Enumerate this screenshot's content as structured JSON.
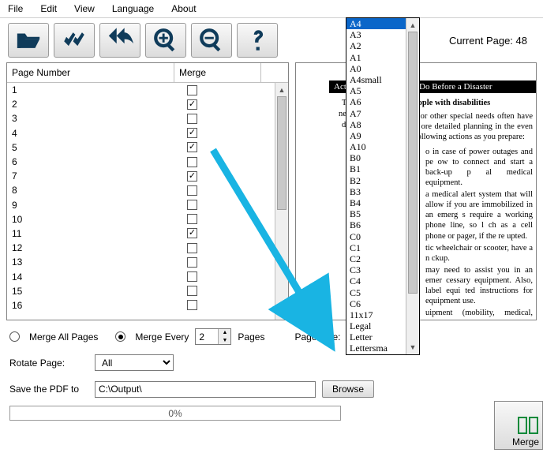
{
  "menu": {
    "file": "File",
    "edit": "Edit",
    "view": "View",
    "language": "Language",
    "about": "About"
  },
  "toolbar": {
    "icons": {
      "open": "open-icon",
      "apply": "apply-icon",
      "undo": "undo-icon",
      "zoomin": "zoomin-icon",
      "zoomout": "zoomout-icon",
      "help": "help-icon"
    },
    "current_page_label": "Current Page: 48"
  },
  "grid": {
    "header_page": "Page Number",
    "header_merge": "Merge",
    "rows": [
      {
        "n": "1",
        "checked": false
      },
      {
        "n": "2",
        "checked": true
      },
      {
        "n": "3",
        "checked": false
      },
      {
        "n": "4",
        "checked": true
      },
      {
        "n": "5",
        "checked": true
      },
      {
        "n": "6",
        "checked": false
      },
      {
        "n": "7",
        "checked": true
      },
      {
        "n": "8",
        "checked": false
      },
      {
        "n": "9",
        "checked": false
      },
      {
        "n": "10",
        "checked": false
      },
      {
        "n": "11",
        "checked": true
      },
      {
        "n": "12",
        "checked": false
      },
      {
        "n": "13",
        "checked": false
      },
      {
        "n": "14",
        "checked": false
      },
      {
        "n": "15",
        "checked": false
      },
      {
        "n": "16",
        "checked": false
      }
    ]
  },
  "preview": {
    "bar1": "Action",
    "bar2": "Do Before a Disaster",
    "title": "eople with disabilities",
    "para": "s or other special needs often have u ore detailed planning in the even following actions as you prepare:",
    "bullets": [
      "o in case of power outages and pe   ow to connect and start a back-up p   al medical equipment.",
      "a medical alert system that will allow   if you are immobilized in an emerg   s require a working phone line, so l   ch as a cell phone or pager, if the re   upted.",
      "tic wheelchair or scooter, have a n   ckup.",
      "may need to assist you in an emer   cessary equipment. Also, label equi   ted instructions for equipment use.",
      "uipment (mobility, medical, etc.) a   school, or your workplace."
    ],
    "snip1": "T",
    "snip2": "ne",
    "snip3": "di"
  },
  "controls": {
    "merge_all": "Merge All Pages",
    "merge_every": "Merge Every",
    "merge_every_value": "2",
    "pages_label": "Pages",
    "page_size_label": "Page Size:",
    "page_size_value": "A4",
    "rotate_label": "Rotate Page:",
    "rotate_value": "All",
    "save_label": "Save the PDF to",
    "save_path": "C:\\Output\\",
    "browse": "Browse",
    "progress": "0%",
    "merge_button": "Merge"
  },
  "dropdown": {
    "selected": "A4",
    "items": [
      "A4",
      "A3",
      "A2",
      "A1",
      "A0",
      "A4small",
      "A5",
      "A6",
      "A7",
      "A8",
      "A9",
      "A10",
      "B0",
      "B1",
      "B2",
      "B3",
      "B4",
      "B5",
      "B6",
      "C0",
      "C1",
      "C2",
      "C3",
      "C4",
      "C5",
      "C6",
      "11x17",
      "Legal",
      "Letter",
      "Lettersma"
    ]
  },
  "chart_data": null
}
